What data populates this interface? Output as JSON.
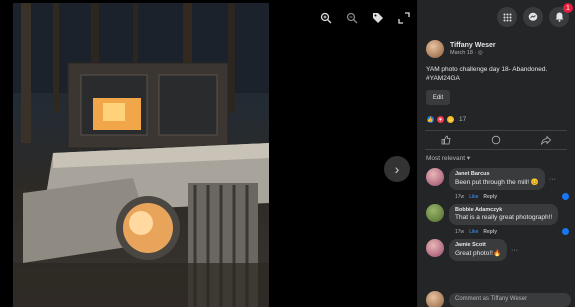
{
  "viewer": {
    "tools": [
      "zoom-in-icon",
      "zoom-out-icon",
      "tag-icon",
      "fullscreen-icon"
    ],
    "next_icon": "chevron-right-icon"
  },
  "topbar": {
    "icons": [
      "menu-grid-icon",
      "messenger-icon",
      "notifications-icon"
    ],
    "notification_count": "1"
  },
  "post": {
    "author": "Tiffany Weser",
    "date": "March 18 ·",
    "caption": "YAM photo challenge day 18- Abandoned. #YAM24GA",
    "edit_label": "Edit",
    "reaction_count": "17"
  },
  "comments_sort": "Most relevant ▾",
  "comments": [
    {
      "name": "Janet Barcus",
      "text": "Been put through the mill! 😊",
      "time": "17w",
      "like": "Like",
      "reply": "Reply"
    },
    {
      "name": "Bobbie Adamczyk",
      "text": "That is a really great photograph!!",
      "time": "17w",
      "like": "Like",
      "reply": "Reply"
    },
    {
      "name": "Jamie Scott",
      "text": "Great photo!!🔥",
      "time": "",
      "like": "",
      "reply": ""
    }
  ],
  "write_placeholder": "Comment as Tiffany Weser",
  "colors": {
    "panel_bg": "#242526",
    "accent": "#1877f2"
  }
}
